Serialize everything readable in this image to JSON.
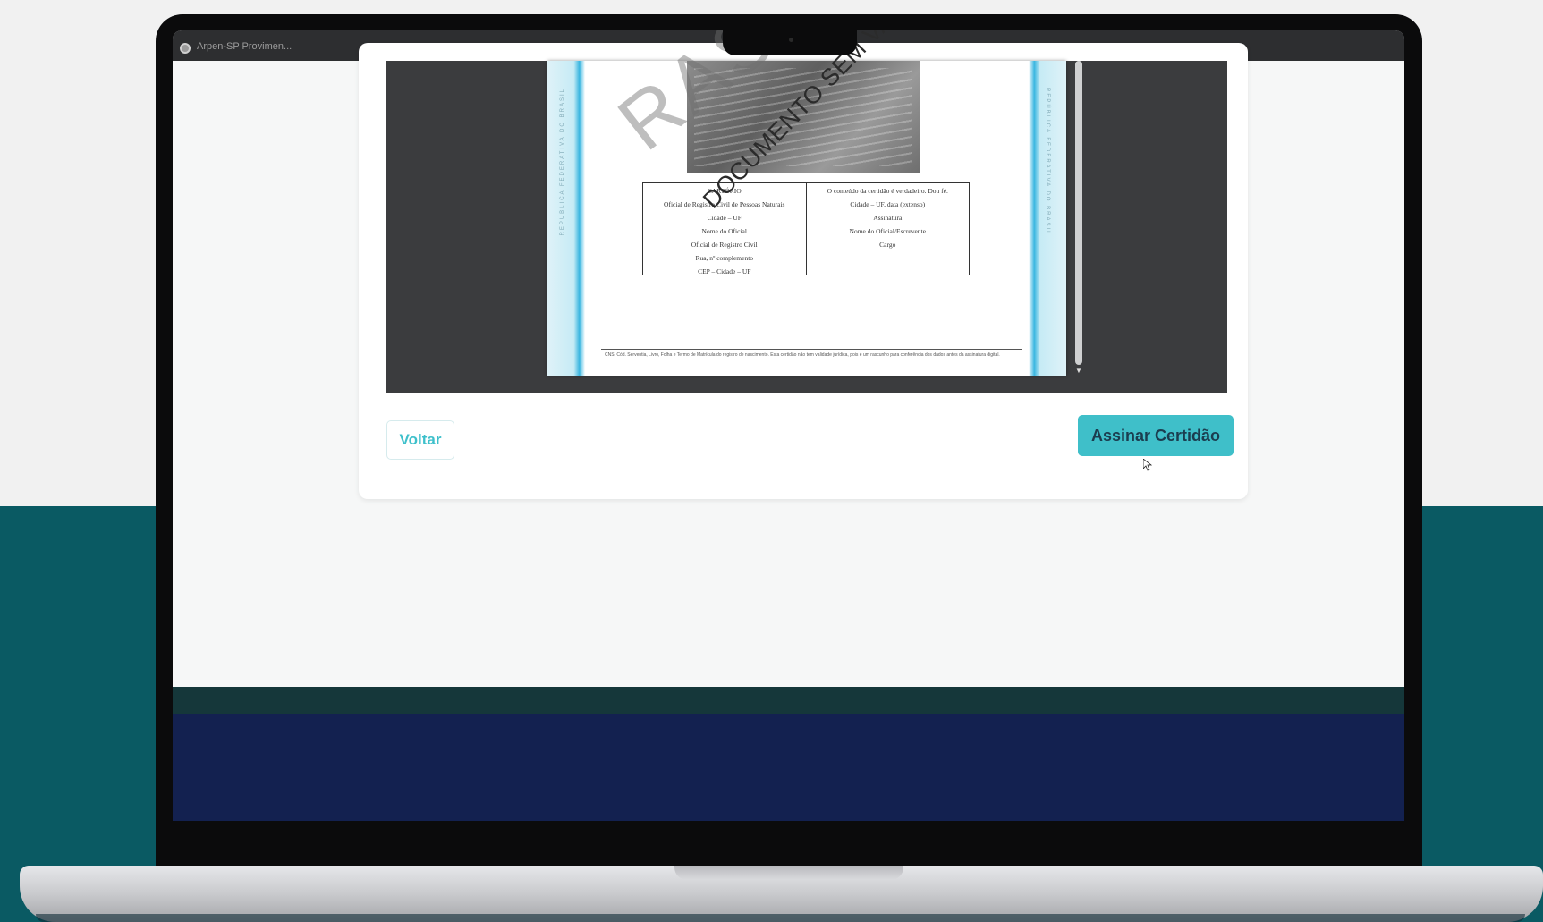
{
  "window": {
    "title": "Arpen-SP Provimen..."
  },
  "document": {
    "watermark_rascunho": "RASCUNHO",
    "watermark_documento": "DOCUMENTO SEM VALOR",
    "border_text": "REPÚBLICA FEDERATIVA DO BRASIL",
    "table_left": [
      "CARTÓRIO",
      "Oficial de Registro Civil de Pessoas Naturais",
      "Cidade – UF",
      "Nome do Oficial",
      "Oficial de Registro Civil",
      "Rua, nº complemento",
      "CEP – Cidade – UF"
    ],
    "table_right": [
      "O conteúdo da certidão é verdadeiro. Dou fé.",
      "Cidade – UF, data (extenso)",
      "Assinatura",
      "Nome do Oficial/Escrevente",
      "Cargo"
    ],
    "footer_text": "CNS, Cód. Serventia, Livro, Folha e Termo de Matrícula do registro de nascimento. Esta certidão não tem validade jurídica, pois é um rascunho para conferência dos dados antes da assinatura digital."
  },
  "actions": {
    "back_label": "Voltar",
    "sign_label": "Assinar Certidão"
  },
  "icons": {
    "app_icon": "globe-icon",
    "cursor": "mouse-pointer-icon"
  },
  "colors": {
    "accent": "#3fbfc9",
    "teal_background": "#0a5a63",
    "navy_footer": "#132150"
  }
}
